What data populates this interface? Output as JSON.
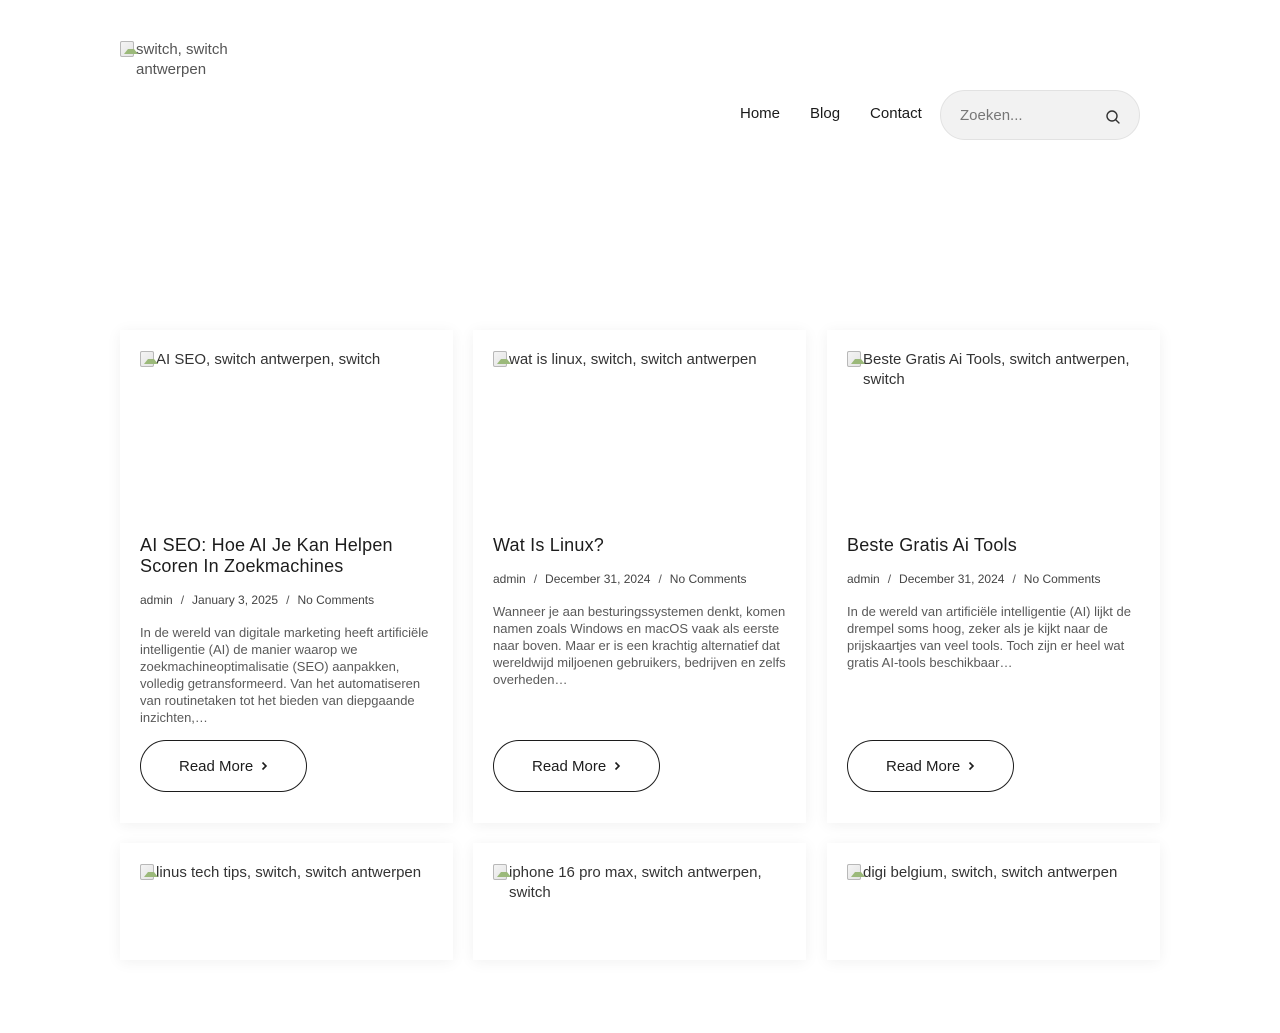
{
  "header": {
    "logo_alt": "switch, switch antwerpen",
    "nav": [
      "Home",
      "Blog",
      "Contact"
    ],
    "search_placeholder": "Zoeken..."
  },
  "posts": [
    {
      "image_alt": "AI SEO, switch antwerpen, switch",
      "title": "AI SEO: Hoe AI Je Kan Helpen Scoren In Zoekmachines",
      "author": "admin",
      "date": "January 3, 2025",
      "comments": "No Comments",
      "excerpt": "In de wereld van digitale marketing heeft artificiële intelligentie (AI) de manier waarop we zoekmachineoptimalisatie (SEO) aanpakken, volledig getransformeerd. Van het automatiseren van routinetaken tot het bieden van diepgaande inzichten,…",
      "read_more": "Read More"
    },
    {
      "image_alt": "wat is linux, switch, switch antwerpen",
      "title": "Wat Is Linux?",
      "author": "admin",
      "date": "December 31, 2024",
      "comments": "No Comments",
      "excerpt": "Wanneer je aan besturingssystemen denkt, komen namen zoals Windows en macOS vaak als eerste naar boven. Maar er is een krachtig alternatief dat wereldwijd miljoenen gebruikers, bedrijven en zelfs overheden…",
      "read_more": "Read More"
    },
    {
      "image_alt": "Beste Gratis Ai Tools, switch antwerpen, switch",
      "title": "Beste Gratis Ai Tools",
      "author": "admin",
      "date": "December 31, 2024",
      "comments": "No Comments",
      "excerpt": "In de wereld van artificiële intelligentie (AI) lijkt de drempel soms hoog, zeker als je kijkt naar de prijskaartjes van veel tools. Toch zijn er heel wat gratis AI-tools beschikbaar…",
      "read_more": "Read More"
    },
    {
      "image_alt": "linus tech tips, switch, switch antwerpen"
    },
    {
      "image_alt": "iphone 16 pro max, switch antwerpen, switch"
    },
    {
      "image_alt": "digi belgium, switch, switch antwerpen"
    }
  ],
  "colors": {
    "text": "#1c1c1c",
    "muted": "#5a5a5a",
    "search_bg": "#f2f2f2"
  }
}
